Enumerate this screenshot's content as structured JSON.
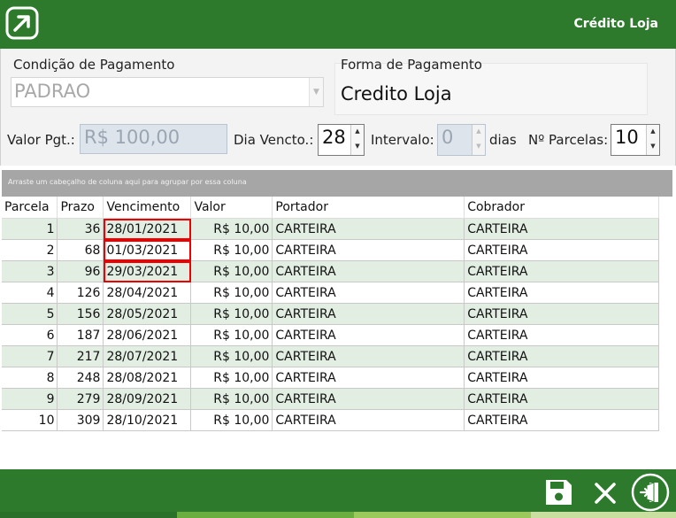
{
  "app": {
    "title": "Crédito Loja",
    "logo_icon": "external-link-square-icon"
  },
  "colors": {
    "brand_green": "#2d7a2d",
    "row_alt": "#e3eee3",
    "highlight": "#e00000"
  },
  "condicao": {
    "label": "Condição de Pagamento",
    "value": "PADRAO"
  },
  "forma": {
    "label": "Forma de Pagamento",
    "value": "Credito Loja"
  },
  "controls": {
    "valor_label": "Valor Pgt.:",
    "valor_value": "R$ 100,00",
    "dia_label": "Dia Vencto.:",
    "dia_value": "28",
    "intervalo_label": "Intervalo:",
    "intervalo_value": "0",
    "dias_label": "dias",
    "parcelas_label": "Nº Parcelas:",
    "parcelas_value": "10"
  },
  "grid": {
    "group_hint": "Arraste um cabeçalho de coluna aqui para agrupar por essa coluna",
    "columns": [
      "Parcela",
      "Prazo",
      "Vencimento",
      "Valor",
      "Portador",
      "Cobrador"
    ],
    "rows": [
      {
        "parcela": "1",
        "prazo": "36",
        "vencimento": "28/01/2021",
        "valor": "R$ 10,00",
        "portador": "CARTEIRA",
        "cobrador": "CARTEIRA"
      },
      {
        "parcela": "2",
        "prazo": "68",
        "vencimento": "01/03/2021",
        "valor": "R$ 10,00",
        "portador": "CARTEIRA",
        "cobrador": "CARTEIRA"
      },
      {
        "parcela": "3",
        "prazo": "96",
        "vencimento": "29/03/2021",
        "valor": "R$ 10,00",
        "portador": "CARTEIRA",
        "cobrador": "CARTEIRA"
      },
      {
        "parcela": "4",
        "prazo": "126",
        "vencimento": "28/04/2021",
        "valor": "R$ 10,00",
        "portador": "CARTEIRA",
        "cobrador": "CARTEIRA"
      },
      {
        "parcela": "5",
        "prazo": "156",
        "vencimento": "28/05/2021",
        "valor": "R$ 10,00",
        "portador": "CARTEIRA",
        "cobrador": "CARTEIRA"
      },
      {
        "parcela": "6",
        "prazo": "187",
        "vencimento": "28/06/2021",
        "valor": "R$ 10,00",
        "portador": "CARTEIRA",
        "cobrador": "CARTEIRA"
      },
      {
        "parcela": "7",
        "prazo": "217",
        "vencimento": "28/07/2021",
        "valor": "R$ 10,00",
        "portador": "CARTEIRA",
        "cobrador": "CARTEIRA"
      },
      {
        "parcela": "8",
        "prazo": "248",
        "vencimento": "28/08/2021",
        "valor": "R$ 10,00",
        "portador": "CARTEIRA",
        "cobrador": "CARTEIRA"
      },
      {
        "parcela": "9",
        "prazo": "279",
        "vencimento": "28/09/2021",
        "valor": "R$ 10,00",
        "portador": "CARTEIRA",
        "cobrador": "CARTEIRA"
      },
      {
        "parcela": "10",
        "prazo": "309",
        "vencimento": "28/10/2021",
        "valor": "R$ 10,00",
        "portador": "CARTEIRA",
        "cobrador": "CARTEIRA"
      }
    ]
  },
  "footer": {
    "icons": [
      "save-icon",
      "close-icon",
      "exit-icon"
    ]
  }
}
